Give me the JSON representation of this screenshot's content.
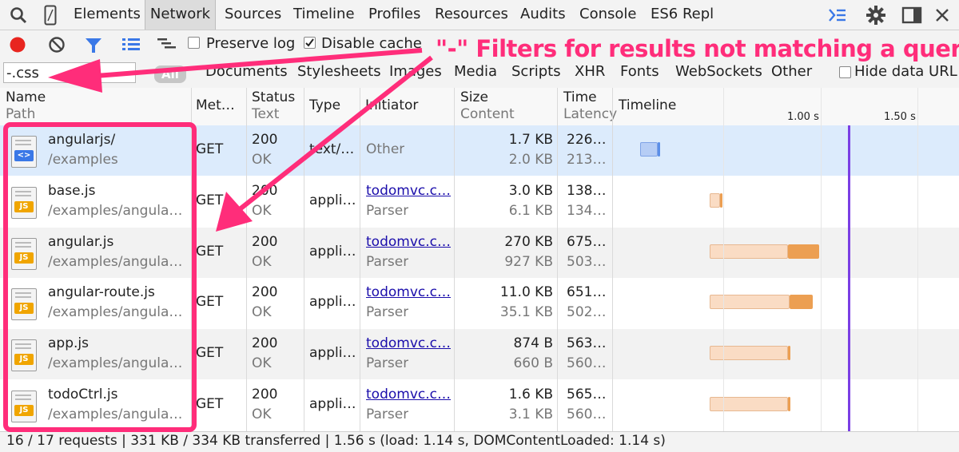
{
  "tabs": [
    "Elements",
    "Network",
    "Sources",
    "Timeline",
    "Profiles",
    "Resources",
    "Audits",
    "Console",
    "ES6 Repl"
  ],
  "toolbar": {
    "preserve_log": "Preserve log",
    "disable_cache": "Disable cache"
  },
  "filter": {
    "value": "-.css",
    "all": "All",
    "types": [
      "Documents",
      "Stylesheets",
      "Images",
      "Media",
      "Scripts",
      "XHR",
      "Fonts",
      "WebSockets",
      "Other"
    ],
    "hide_data_url": "Hide data URL"
  },
  "annotation": "\"-\" Filters for results not matching a query",
  "columns": {
    "name": [
      "Name",
      "Path"
    ],
    "method": "Met…",
    "status": [
      "Status",
      "Text"
    ],
    "type": "Type",
    "initiator": "Initiator",
    "size": [
      "Size",
      "Content"
    ],
    "time": [
      "Time",
      "Latency"
    ],
    "timeline": "Timeline",
    "tick1": "1.00 s",
    "tick2": "1.50 s"
  },
  "rows": [
    {
      "name": "angularjs/",
      "path": "/examples",
      "method": "GET",
      "status": "200",
      "status_text": "OK",
      "type": "text/…",
      "initiator": "Other",
      "initiator_sub": "",
      "size": "1.7 KB",
      "content": "2.0 KB",
      "time": "226…",
      "latency": "213…",
      "icon": "html-icon",
      "start": 0.07,
      "wait_end": 0.16,
      "end": 0.16,
      "color": "blue"
    },
    {
      "name": "base.js",
      "path": "/examples/angula…",
      "method": "GET",
      "status": "200",
      "status_text": "OK",
      "type": "appli…",
      "initiator": "todomvc.c…",
      "initiator_sub": "Parser",
      "size": "3.0 KB",
      "content": "6.1 KB",
      "time": "138…",
      "latency": "134…",
      "icon": "js-icon",
      "start": 0.43,
      "wait_end": 0.48,
      "end": 0.49,
      "color": "orange"
    },
    {
      "name": "angular.js",
      "path": "/examples/angula…",
      "method": "GET",
      "status": "200",
      "status_text": "OK",
      "type": "appli…",
      "initiator": "todomvc.c…",
      "initiator_sub": "Parser",
      "size": "270 KB",
      "content": "927 KB",
      "time": "675…",
      "latency": "503…",
      "icon": "js-icon",
      "start": 0.43,
      "wait_end": 0.83,
      "end": 0.99,
      "color": "orange"
    },
    {
      "name": "angular-route.js",
      "path": "/examples/angula…",
      "method": "GET",
      "status": "200",
      "status_text": "OK",
      "type": "appli…",
      "initiator": "todomvc.c…",
      "initiator_sub": "Parser",
      "size": "11.0 KB",
      "content": "35.1 KB",
      "time": "651…",
      "latency": "502…",
      "icon": "js-icon",
      "start": 0.43,
      "wait_end": 0.84,
      "end": 0.96,
      "color": "orange"
    },
    {
      "name": "app.js",
      "path": "/examples/angula…",
      "method": "GET",
      "status": "200",
      "status_text": "OK",
      "type": "appli…",
      "initiator": "todomvc.c…",
      "initiator_sub": "Parser",
      "size": "874 B",
      "content": "660 B",
      "time": "563…",
      "latency": "560…",
      "icon": "js-icon",
      "start": 0.43,
      "wait_end": 0.83,
      "end": 0.84,
      "color": "orange"
    },
    {
      "name": "todoCtrl.js",
      "path": "/examples/angula…",
      "method": "GET",
      "status": "200",
      "status_text": "OK",
      "type": "appli…",
      "initiator": "todomvc.c…",
      "initiator_sub": "Parser",
      "size": "1.6 KB",
      "content": "3.1 KB",
      "time": "565…",
      "latency": "560…",
      "icon": "js-icon",
      "start": 0.43,
      "wait_end": 0.83,
      "end": 0.84,
      "color": "orange"
    }
  ],
  "load_time": 1.14,
  "status_bar": "16 / 17 requests | 331 KB / 334 KB transferred | 1.56 s (load: 1.14 s, DOMContentLoaded: 1.14 s)"
}
